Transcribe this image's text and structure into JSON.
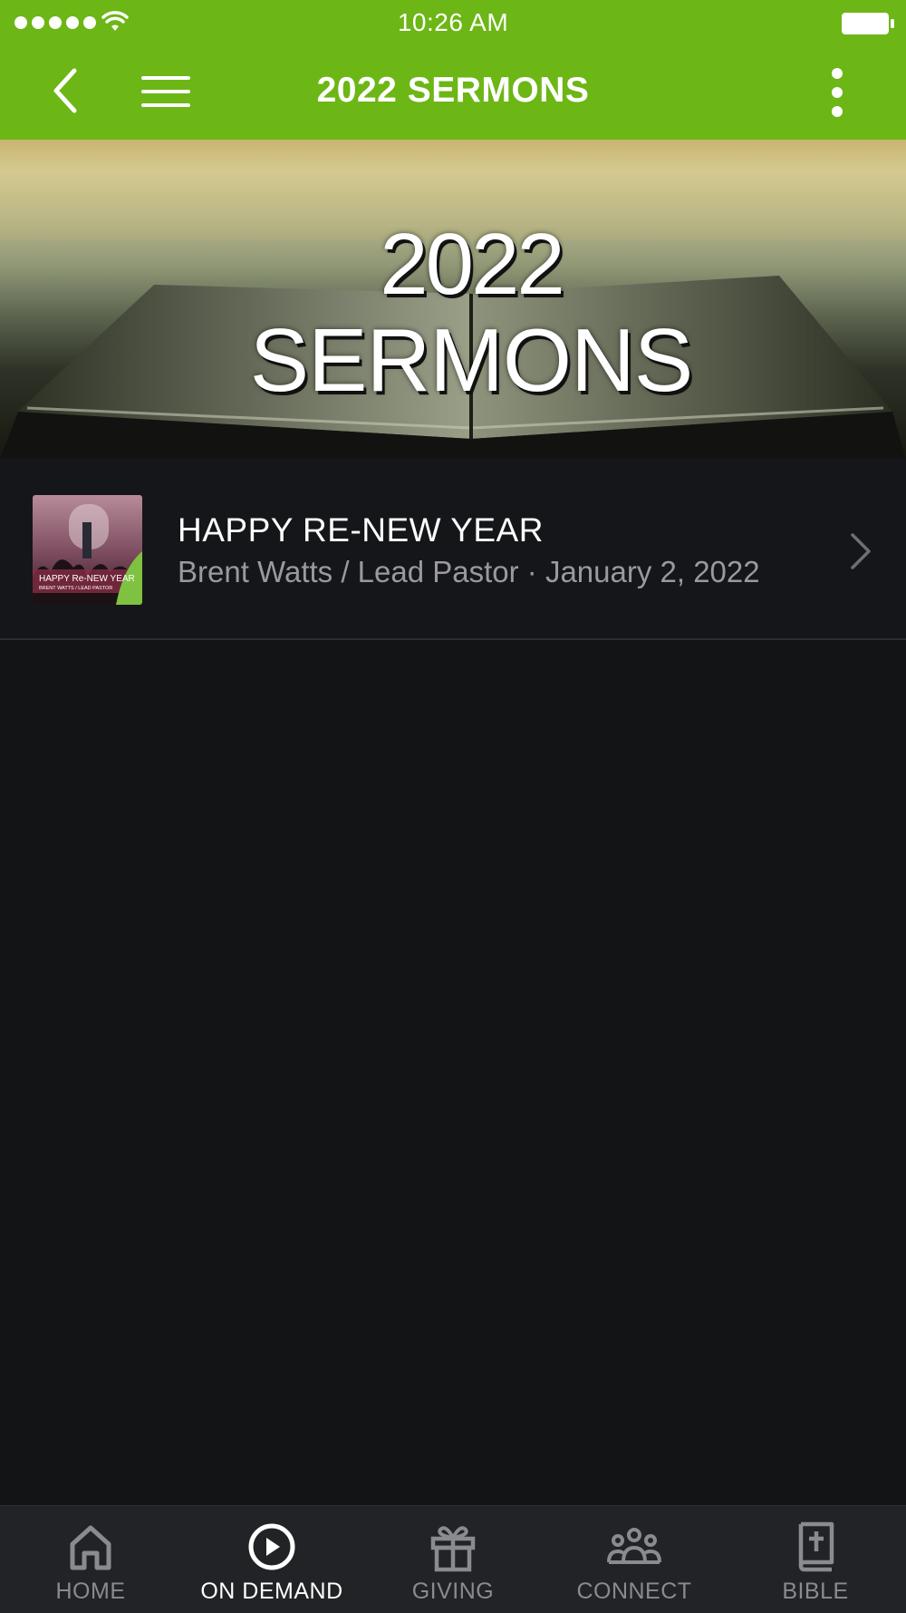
{
  "status_bar": {
    "time": "10:26 AM"
  },
  "header": {
    "title": "2022 SERMONS"
  },
  "hero": {
    "year": "2022",
    "label": "SERMONS"
  },
  "sermons": [
    {
      "title": "HAPPY RE-NEW YEAR",
      "subtitle": "Brent Watts / Lead Pastor · January 2, 2022",
      "thumb_text": "HAPPY Re-NEW YEAR",
      "thumb_subtext": "BRENT WATTS / LEAD PASTOR"
    }
  ],
  "tabs": [
    {
      "label": "HOME",
      "icon": "home-icon",
      "active": false
    },
    {
      "label": "ON DEMAND",
      "icon": "play-circle-icon",
      "active": true
    },
    {
      "label": "GIVING",
      "icon": "gift-icon",
      "active": false
    },
    {
      "label": "CONNECT",
      "icon": "people-icon",
      "active": false
    },
    {
      "label": "BIBLE",
      "icon": "bible-icon",
      "active": false
    }
  ],
  "colors": {
    "accent": "#6cb616",
    "background": "#131416",
    "tabbar": "#222326"
  }
}
